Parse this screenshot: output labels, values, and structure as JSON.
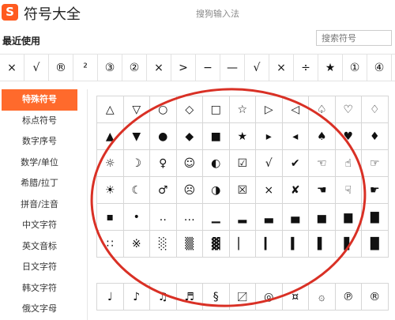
{
  "header": {
    "logo_letter": "S",
    "title": "符号大全",
    "ime_name": "搜狗输入法"
  },
  "recent": {
    "label": "最近使用",
    "search_placeholder": "搜索符号",
    "symbols": [
      "×",
      "√",
      "®",
      "²",
      "③",
      "②",
      "×",
      ">",
      "−",
      "—",
      "√",
      "×",
      "÷",
      "★",
      "①",
      "④"
    ]
  },
  "sidebar": {
    "items": [
      {
        "label": "特殊符号",
        "active": true
      },
      {
        "label": "标点符号",
        "active": false
      },
      {
        "label": "数字序号",
        "active": false
      },
      {
        "label": "数学/单位",
        "active": false
      },
      {
        "label": "希腊/拉丁",
        "active": false
      },
      {
        "label": "拼音/注音",
        "active": false
      },
      {
        "label": "中文字符",
        "active": false
      },
      {
        "label": "英文音标",
        "active": false
      },
      {
        "label": "日文字符",
        "active": false
      },
      {
        "label": "韩文字符",
        "active": false
      },
      {
        "label": "俄文字母",
        "active": false
      }
    ]
  },
  "symbols_grid": {
    "rows": [
      [
        "△",
        "▽",
        "○",
        "◇",
        "□",
        "☆",
        "▷",
        "◁",
        "♤",
        "♡",
        "♢"
      ],
      [
        "▲",
        "▼",
        "●",
        "◆",
        "■",
        "★",
        "▸",
        "◂",
        "♠",
        "♥",
        "♦"
      ],
      [
        "☼",
        "☽",
        "♀",
        "☺",
        "◐",
        "☑",
        "√",
        "✔",
        "☜",
        "☝",
        "☞"
      ],
      [
        "☀",
        "☾",
        "♂",
        "☹",
        "◑",
        "☒",
        "×",
        "✘",
        "☚",
        "☟",
        "☛"
      ],
      [
        "▪",
        "•",
        "‥",
        "…",
        "▁",
        "▂",
        "▃",
        "▄",
        "▅",
        "▆",
        "▇"
      ],
      [
        "∷",
        "※",
        "░",
        "▒",
        "▓",
        "▏",
        "▎",
        "▍",
        "▌",
        "▋",
        "█"
      ]
    ],
    "rows_lower": [
      [
        "♩",
        "♪",
        "♫",
        "♬",
        "§",
        "〼",
        "◎",
        "¤",
        "۞",
        "℗",
        "®"
      ]
    ]
  },
  "annotation": {
    "color": "#d93025"
  }
}
